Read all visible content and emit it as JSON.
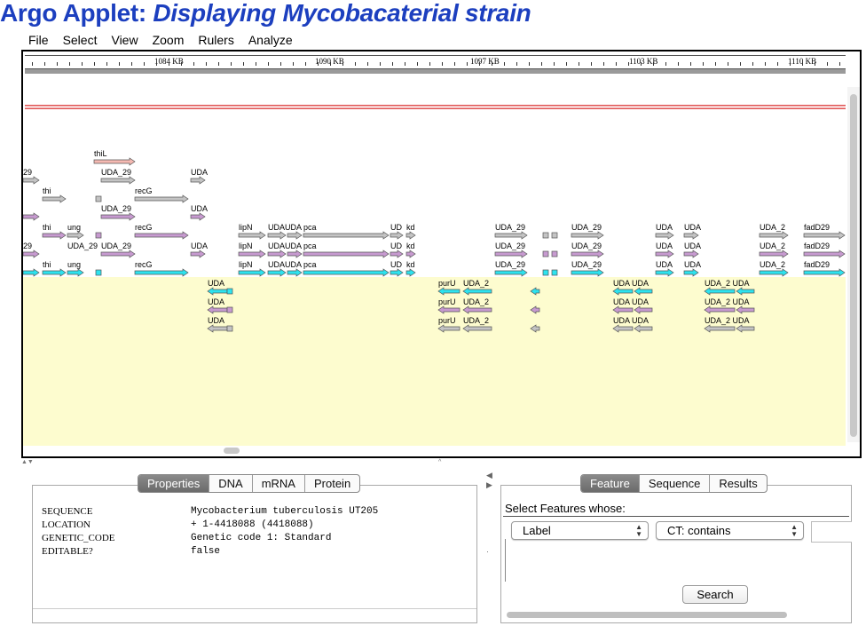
{
  "page": {
    "title_prefix": "Argo Applet: ",
    "title_emphasis": "Displaying Mycobacaterial strain"
  },
  "menu": [
    "File",
    "Select",
    "View",
    "Zoom",
    "Rulers",
    "Analyze"
  ],
  "ruler": {
    "labels": [
      "1084 KB",
      "1090 KB",
      "1097 KB",
      "1103 KB",
      "1110 KB"
    ]
  },
  "colors": {
    "title": "#1c3fbf",
    "gray_feature": "#c4c4c4",
    "purple_feature": "#c79ad0",
    "cyan_feature": "#2de3ef",
    "salmon_feature": "#f5b9b2",
    "reverse_background": "#fdfccf",
    "red_track": "#dd4444"
  },
  "features": [
    {
      "label": "thiL",
      "color": "salmon",
      "strand": "forward"
    },
    {
      "label": "UDA_29",
      "color": "gray",
      "strand": "forward"
    },
    {
      "label": "recG",
      "color": "gray",
      "strand": "forward"
    },
    {
      "label": "ung",
      "color": "purple",
      "strand": "forward"
    },
    {
      "label": "lipN",
      "color": "purple",
      "strand": "forward"
    },
    {
      "label": "pca",
      "color": "cyan",
      "strand": "forward"
    },
    {
      "label": "fadD29",
      "color": "cyan",
      "strand": "forward"
    },
    {
      "label": "purU",
      "color": "cyan",
      "strand": "reverse"
    },
    {
      "label": "UDA_2",
      "color": "purple",
      "strand": "reverse"
    }
  ],
  "track_text": {
    "thiL": "thiL",
    "thi": "thi",
    "ung": "ung",
    "uda29": "UDA_29",
    "uda_frag": "UDA",
    "recG": "recG",
    "lipN": "lipN",
    "udaud": "UDAUDA",
    "pca": "pca",
    "ud": "UD",
    "kd": "kd",
    "uda_29b": "UDA_29",
    "uda_29c": "UDA_29",
    "uda_short": "UDA",
    "uda_2": "UDA_2",
    "fadD29": "fadD29",
    "purU": "purU",
    "uda_rev": "UDA",
    "udauda": "UDA UDA",
    "uda2uda": "UDA_2 UDA",
    "a29": "29"
  },
  "tabs_left": [
    "Properties",
    "DNA",
    "mRNA",
    "Protein"
  ],
  "tabs_left_active": "Properties",
  "properties": [
    {
      "key": "SEQUENCE",
      "value": "Mycobacterium tuberculosis UT205"
    },
    {
      "key": "LOCATION",
      "value": "+ 1-4418088 (4418088)"
    },
    {
      "key": "GENETIC_CODE",
      "value": "Genetic code 1: Standard"
    },
    {
      "key": "EDITABLE?",
      "value": "false"
    }
  ],
  "tabs_right": [
    "Feature",
    "Sequence",
    "Results"
  ],
  "tabs_right_active": "Feature",
  "feature_search": {
    "prompt": "Select Features whose:",
    "field_value": "Label",
    "operator_value": "CT: contains",
    "search_label": "Search"
  }
}
